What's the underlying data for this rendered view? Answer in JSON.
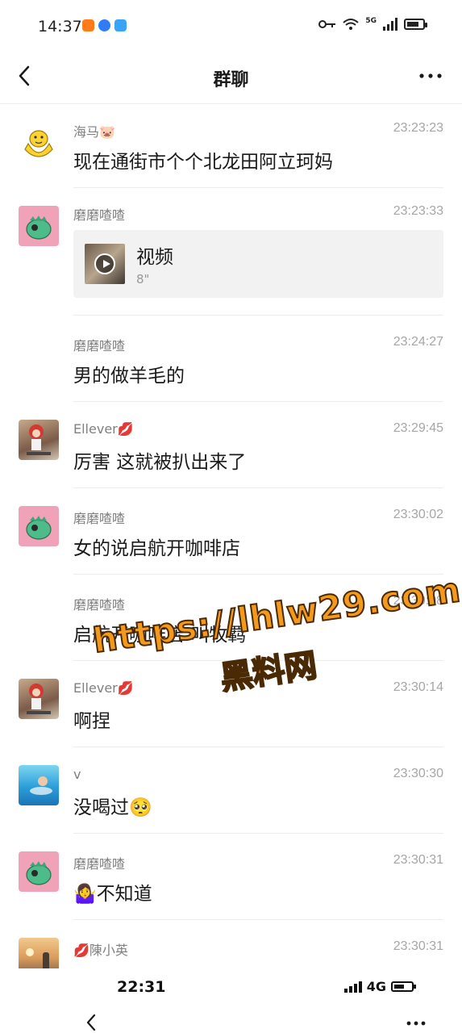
{
  "status_bar": {
    "time": "14:37",
    "network": "5G",
    "battery_level": 0.8
  },
  "nav": {
    "title": "群聊"
  },
  "messages": [
    {
      "sender": "海马🐷",
      "time": "23:23:23",
      "text": "现在通街市个个北龙田阿立珂妈",
      "avatar": "yellow-character-avatar"
    },
    {
      "sender": "磨磨喳喳",
      "time": "23:23:33",
      "video_label": "视频",
      "video_duration": "8\"",
      "avatar": "green-dino-avatar"
    },
    {
      "sender": "磨磨喳喳",
      "time": "23:24:27",
      "text": "男的做羊毛的"
    },
    {
      "sender": "Ellever💋",
      "time": "23:29:45",
      "text": "厉害 这就被扒出来了",
      "avatar": "girl-avatar"
    },
    {
      "sender": "磨磨喳喳",
      "time": "23:30:02",
      "text": "女的说启航开咖啡店",
      "avatar": "green-dino-avatar"
    },
    {
      "sender": "磨磨喳喳",
      "time": "23:30:08",
      "text": "启航开咖啡店 叫牧羁"
    },
    {
      "sender": "Ellever💋",
      "time": "23:30:14",
      "text": "啊捏",
      "avatar": "girl-avatar"
    },
    {
      "sender": "v",
      "time": "23:30:30",
      "text": "没喝过🥺",
      "avatar": "pool-avatar"
    },
    {
      "sender": "磨磨喳喳",
      "time": "23:30:31",
      "text": "🤷‍♀️不知道",
      "avatar": "green-dino-avatar"
    },
    {
      "sender": "💋陳小英",
      "time": "23:30:31",
      "avatar": "sunset-avatar"
    }
  ],
  "watermark": {
    "url": "https://lhlw29.com",
    "name": "黑料网"
  },
  "bottom_overlay": {
    "time": "22:31",
    "network": "4G"
  },
  "colors": {
    "accent_orange": "#f39a1c",
    "divider": "#ececec",
    "sender_gray": "#808080"
  }
}
